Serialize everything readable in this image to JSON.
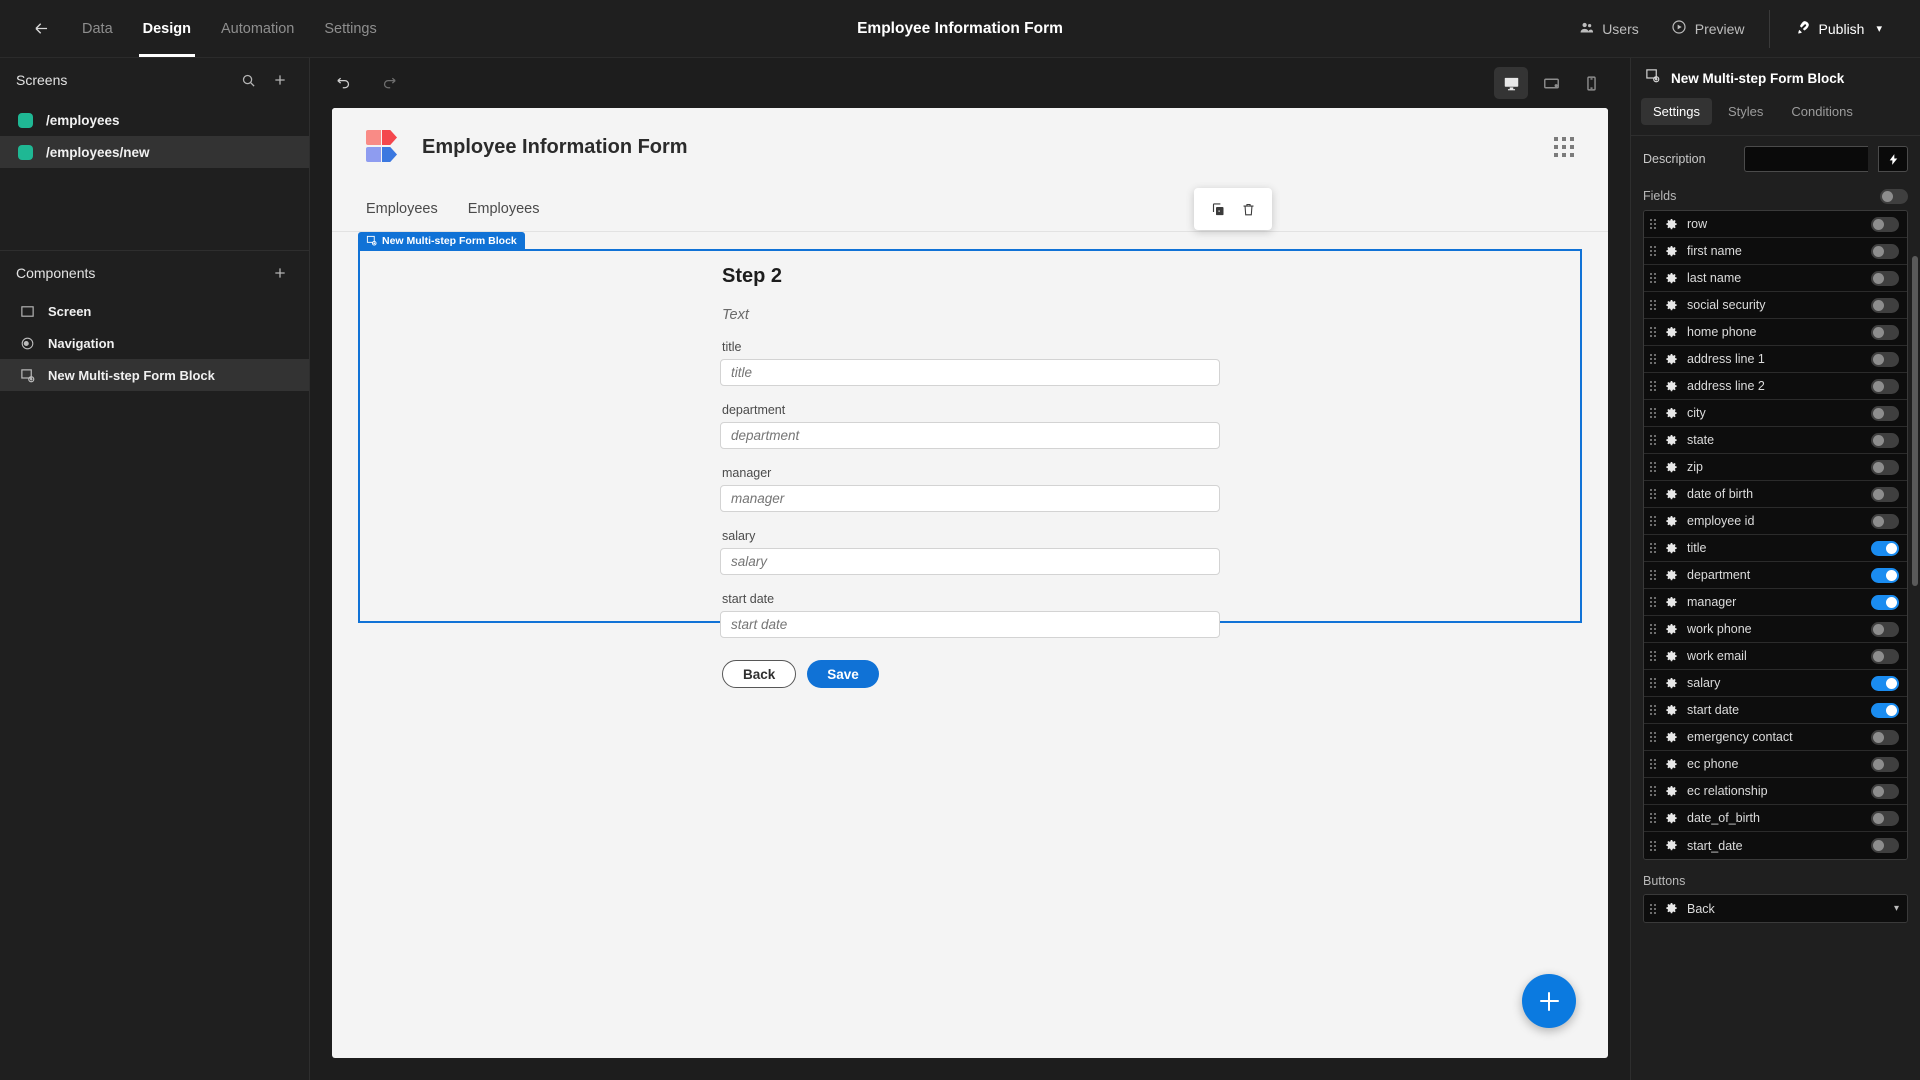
{
  "topbar": {
    "back_icon": "back-arrow-icon",
    "nav": [
      {
        "label": "Data",
        "active": false
      },
      {
        "label": "Design",
        "active": true
      },
      {
        "label": "Automation",
        "active": false
      },
      {
        "label": "Settings",
        "active": false
      }
    ],
    "title": "Employee Information Form",
    "users_label": "Users",
    "preview_label": "Preview",
    "publish_label": "Publish"
  },
  "sidebar": {
    "screens_title": "Screens",
    "screens": [
      {
        "label": "/employees",
        "selected": false
      },
      {
        "label": "/employees/new",
        "selected": true
      }
    ],
    "components_title": "Components",
    "components": [
      {
        "label": "Screen",
        "icon": "screen-icon",
        "selected": false
      },
      {
        "label": "Navigation",
        "icon": "navigation-icon",
        "selected": false
      },
      {
        "label": "New Multi-step Form Block",
        "icon": "form-block-icon",
        "selected": true
      }
    ]
  },
  "canvas": {
    "devices": [
      {
        "name": "desktop",
        "active": true
      },
      {
        "name": "tablet",
        "active": false
      },
      {
        "name": "mobile",
        "active": false
      }
    ],
    "app_title": "Employee Information Form",
    "nav_items": [
      "Employees",
      "Employees"
    ],
    "selection_label": "New Multi-step Form Block",
    "step_title": "Step 2",
    "step_subtitle": "Text",
    "fields": [
      {
        "label": "title",
        "placeholder": "title"
      },
      {
        "label": "department",
        "placeholder": "department"
      },
      {
        "label": "manager",
        "placeholder": "manager"
      },
      {
        "label": "salary",
        "placeholder": "salary"
      },
      {
        "label": "start date",
        "placeholder": "start date"
      }
    ],
    "back_label": "Back",
    "save_label": "Save",
    "accent_color": "#1072d6"
  },
  "inspector": {
    "title": "New Multi-step Form Block",
    "tabs": [
      {
        "label": "Settings",
        "active": true
      },
      {
        "label": "Styles",
        "active": false
      },
      {
        "label": "Conditions",
        "active": false
      }
    ],
    "description_label": "Description",
    "description_value": "",
    "fields_label": "Fields",
    "fields_toggle": false,
    "fields": [
      {
        "name": "row",
        "enabled": false
      },
      {
        "name": "first name",
        "enabled": false
      },
      {
        "name": "last name",
        "enabled": false
      },
      {
        "name": "social security",
        "enabled": false
      },
      {
        "name": "home phone",
        "enabled": false
      },
      {
        "name": "address line 1",
        "enabled": false
      },
      {
        "name": "address line 2",
        "enabled": false
      },
      {
        "name": "city",
        "enabled": false
      },
      {
        "name": "state",
        "enabled": false
      },
      {
        "name": "zip",
        "enabled": false
      },
      {
        "name": "date of birth",
        "enabled": false
      },
      {
        "name": "employee id",
        "enabled": false
      },
      {
        "name": "title",
        "enabled": true
      },
      {
        "name": "department",
        "enabled": true
      },
      {
        "name": "manager",
        "enabled": true
      },
      {
        "name": "work phone",
        "enabled": false
      },
      {
        "name": "work email",
        "enabled": false
      },
      {
        "name": "salary",
        "enabled": true
      },
      {
        "name": "start date",
        "enabled": true
      },
      {
        "name": "emergency contact",
        "enabled": false
      },
      {
        "name": "ec phone",
        "enabled": false
      },
      {
        "name": "ec relationship",
        "enabled": false
      },
      {
        "name": "date_of_birth",
        "enabled": false
      },
      {
        "name": "start_date",
        "enabled": false
      }
    ],
    "buttons_label": "Buttons",
    "buttons": [
      {
        "name": "Back"
      }
    ]
  }
}
